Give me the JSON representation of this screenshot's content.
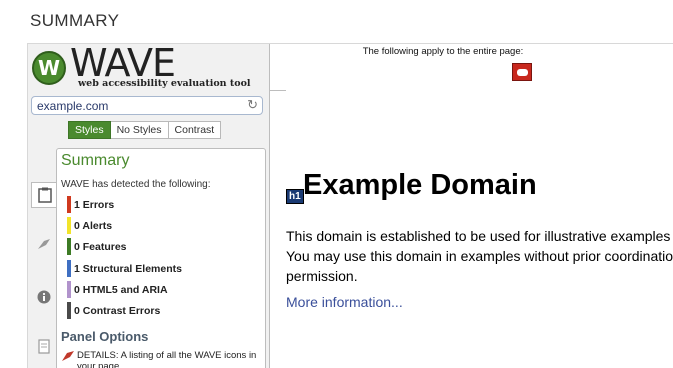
{
  "section_title": "SUMMARY",
  "wave": {
    "logo_mark": "W",
    "logo_text": "WAVE",
    "logo_subtitle": "web accessibility evaluation tool",
    "url": "example.com",
    "style_tabs": [
      "Styles",
      "No Styles",
      "Contrast"
    ],
    "active_style_tab": "Styles",
    "side_icons": [
      "clipboard-icon",
      "flag-icon",
      "info-icon",
      "document-icon"
    ]
  },
  "summary": {
    "title": "Summary",
    "intro": "WAVE has detected the following:",
    "items": [
      {
        "label": "1 Errors",
        "color": "#d0391f"
      },
      {
        "label": "0 Alerts",
        "color": "#f2e42a"
      },
      {
        "label": "0 Features",
        "color": "#3d7b25"
      },
      {
        "label": "1 Structural Elements",
        "color": "#3f6fc2"
      },
      {
        "label": "0 HTML5 and ARIA",
        "color": "#b193cc"
      },
      {
        "label": "0 Contrast Errors",
        "color": "#4a4a4a"
      }
    ]
  },
  "panel_options": {
    "title": "Panel Options",
    "details_text": "DETAILS: A listing of all the WAVE icons in your page"
  },
  "topbar": {
    "text": "The following apply to the entire page:"
  },
  "page": {
    "h1_tag": "h1",
    "heading": "Example Domain",
    "paragraph": "This domain is established to be used for illustrative examples in documents. You may use this domain in examples without prior coordination or asking for permission.",
    "link": "More information..."
  },
  "colors": {
    "brand_green": "#4a8a2e",
    "link": "#3a4f9a",
    "page_icon": "#c8281e"
  }
}
